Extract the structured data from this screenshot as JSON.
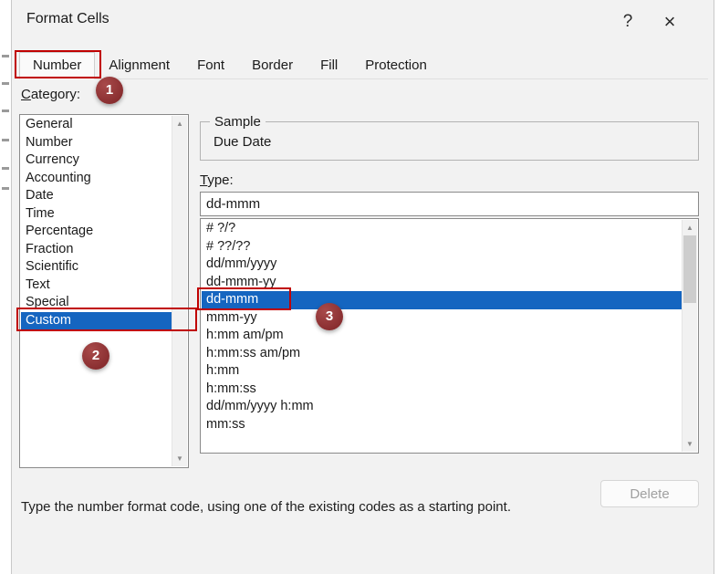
{
  "window": {
    "title": "Format Cells",
    "help": "?",
    "close": "×"
  },
  "tabs": [
    {
      "label": "Number",
      "selected": true
    },
    {
      "label": "Alignment",
      "selected": false
    },
    {
      "label": "Font",
      "selected": false
    },
    {
      "label": "Border",
      "selected": false
    },
    {
      "label": "Fill",
      "selected": false
    },
    {
      "label": "Protection",
      "selected": false
    }
  ],
  "category": {
    "access_key": "C",
    "label_rest": "ategory:",
    "items": [
      "General",
      "Number",
      "Currency",
      "Accounting",
      "Date",
      "Time",
      "Percentage",
      "Fraction",
      "Scientific",
      "Text",
      "Special",
      "Custom"
    ],
    "selected": "Custom"
  },
  "sample": {
    "label": "Sample",
    "value": "Due Date"
  },
  "type": {
    "access_key": "T",
    "label_rest": "ype:",
    "value": "dd-mmm",
    "items": [
      "# ?/?",
      "# ??/??",
      "dd/mm/yyyy",
      "dd-mmm-yy",
      "dd-mmm",
      "mmm-yy",
      "h:mm am/pm",
      "h:mm:ss am/pm",
      "h:mm",
      "h:mm:ss",
      "dd/mm/yyyy h:mm",
      "mm:ss"
    ],
    "selected": "dd-mmm"
  },
  "delete_button": {
    "label": "Delete",
    "enabled": false
  },
  "footer": {
    "hint": "Type the number format code, using one of the existing codes as a starting point."
  },
  "annotations": {
    "step1": "1",
    "step2": "2",
    "step3": "3"
  },
  "icons": {
    "scroll_up": "▲",
    "scroll_down": "▼"
  },
  "colors": {
    "selection_blue": "#1565c0",
    "annotation_red": "#c00000",
    "badge_maroon": "#8b2e31"
  }
}
